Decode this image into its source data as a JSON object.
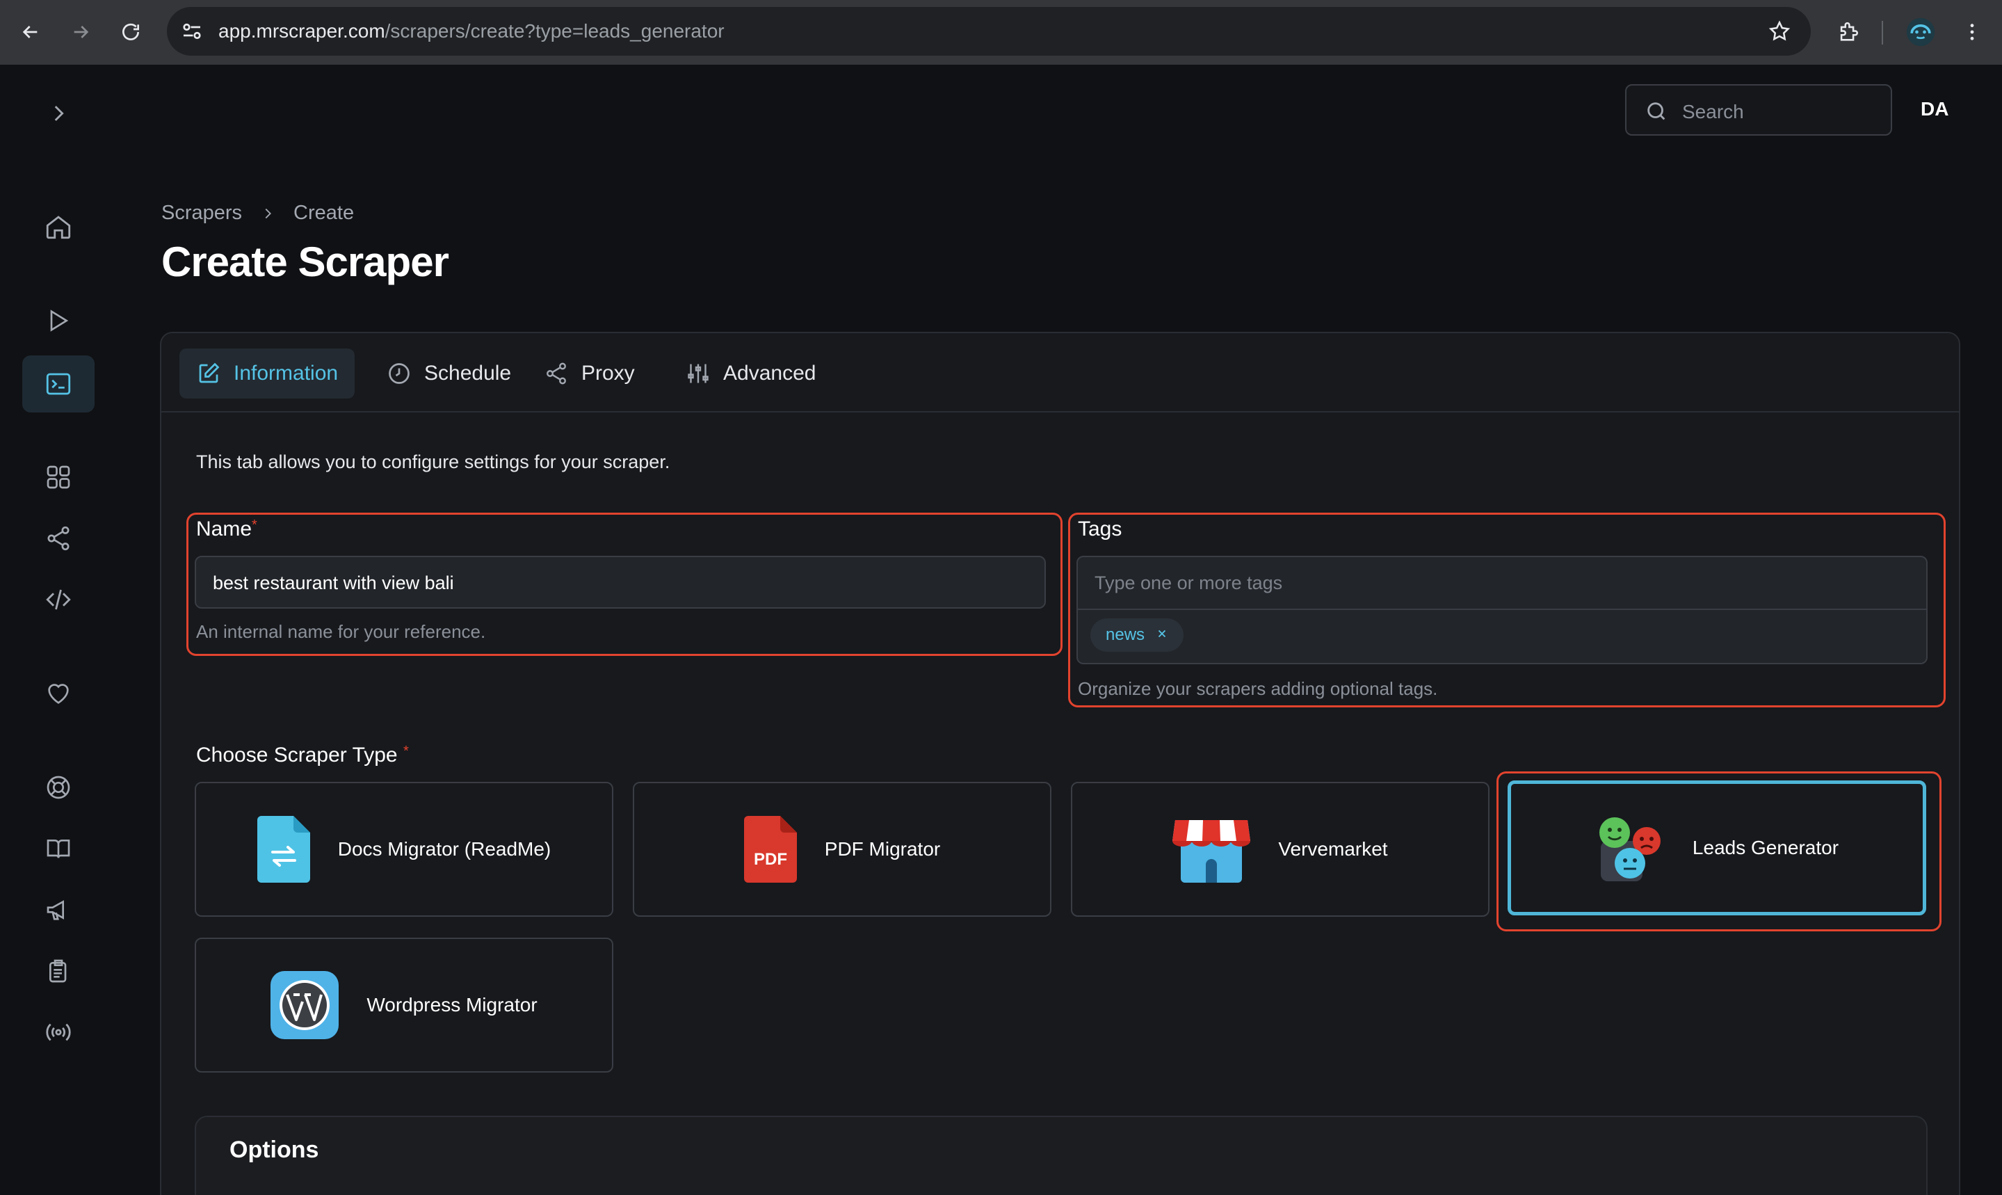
{
  "browser": {
    "url_host": "app.mrscraper.com",
    "url_path": "/scrapers/create?type=leads_generator"
  },
  "header": {
    "search_placeholder": "Search",
    "avatar_initials": "DA"
  },
  "breadcrumb": {
    "items": [
      "Scrapers",
      "Create"
    ]
  },
  "page": {
    "title": "Create Scraper"
  },
  "tabs": [
    {
      "label": "Information",
      "icon": "edit-icon",
      "active": true
    },
    {
      "label": "Schedule",
      "icon": "clock-icon"
    },
    {
      "label": "Proxy",
      "icon": "share-icon"
    },
    {
      "label": "Advanced",
      "icon": "sliders-icon"
    }
  ],
  "info": {
    "description": "This tab allows you to configure settings for your scraper.",
    "name_label": "Name",
    "name_required": "*",
    "name_value": "best restaurant with view bali",
    "name_hint": "An internal name for your reference.",
    "tags_label": "Tags",
    "tags_placeholder": "Type one or more tags",
    "tags": [
      "news"
    ],
    "tags_hint": "Organize your scrapers adding optional tags.",
    "type_label": "Choose Scraper Type",
    "type_required": "*",
    "types": [
      {
        "label": "Docs Migrator (ReadMe)",
        "icon": "docs-migrator-icon"
      },
      {
        "label": "PDF Migrator",
        "icon": "pdf-icon",
        "icon_text": "PDF"
      },
      {
        "label": "Vervemarket",
        "icon": "store-icon"
      },
      {
        "label": "Leads Generator",
        "icon": "leads-faces-icon",
        "selected": true
      },
      {
        "label": "Wordpress Migrator",
        "icon": "wordpress-icon"
      }
    ],
    "options_title": "Options"
  },
  "colors": {
    "accent": "#55c3e6",
    "highlight_outline": "#e2432e",
    "background": "#101114"
  }
}
